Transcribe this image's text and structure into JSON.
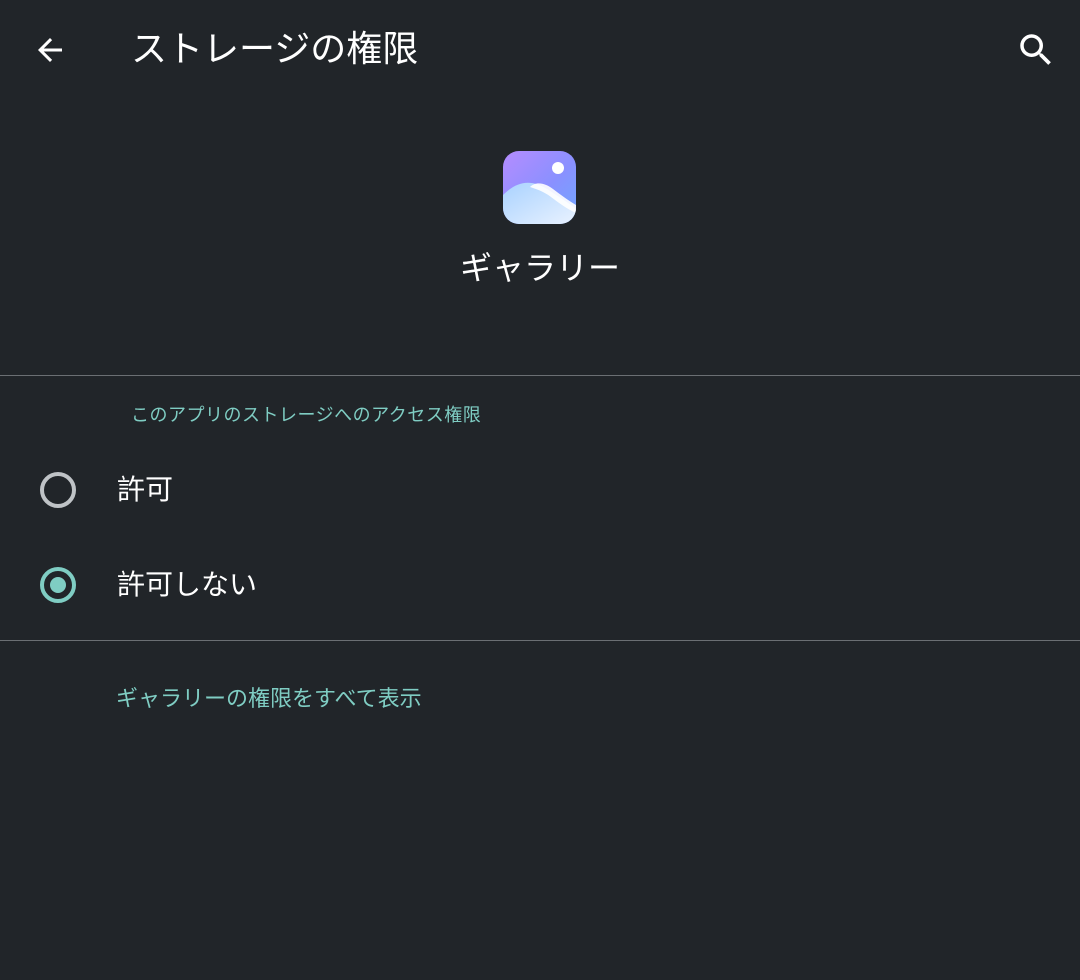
{
  "appbar": {
    "title": "ストレージの権限",
    "back_icon": "arrow-back-icon",
    "search_icon": "search-icon"
  },
  "app": {
    "name": "ギャラリー",
    "icon": "gallery-app-icon"
  },
  "permission": {
    "section_label": "このアプリのストレージへのアクセス権限",
    "options": [
      {
        "label": "許可",
        "selected": false
      },
      {
        "label": "許可しない",
        "selected": true
      }
    ]
  },
  "footer": {
    "link_label": "ギャラリーの権限をすべて表示"
  },
  "colors": {
    "background": "#212529",
    "accent": "#7fcdc3",
    "divider": "#6b6f73",
    "radio_unselected": "#bfc3c6"
  }
}
